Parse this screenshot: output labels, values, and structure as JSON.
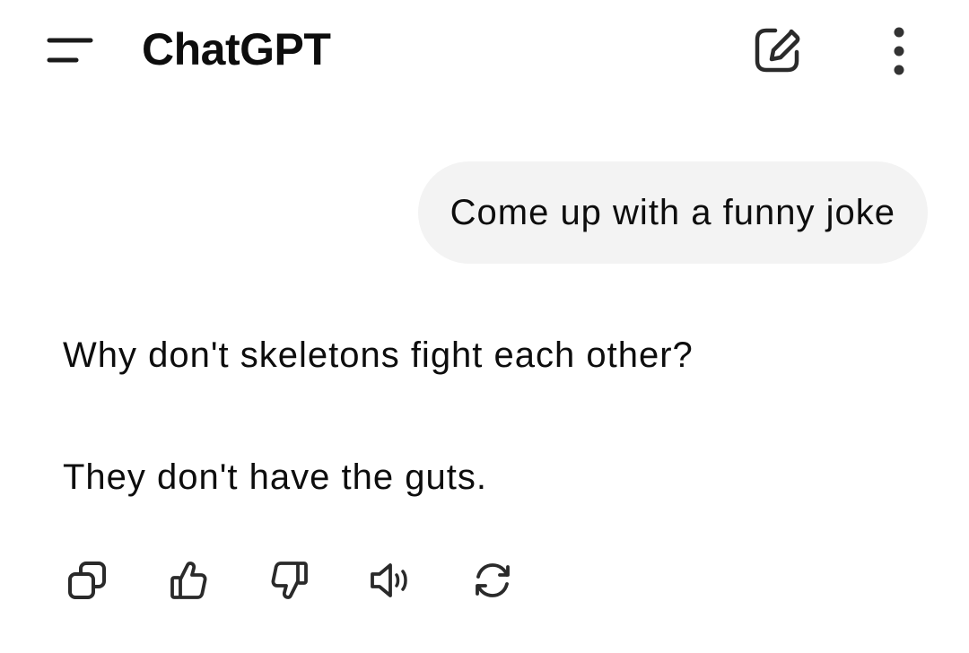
{
  "header": {
    "title": "ChatGPT",
    "menu_icon": "menu-icon",
    "new_chat_icon": "new-chat-icon",
    "more_icon": "more-vertical-icon"
  },
  "conversation": {
    "user_message": "Come up with a funny joke",
    "assistant_lines": [
      "Why don't skeletons fight each other?",
      "They don't have the guts."
    ]
  },
  "message_actions": [
    {
      "icon": "copy-icon"
    },
    {
      "icon": "thumbs-up-icon"
    },
    {
      "icon": "thumbs-down-icon"
    },
    {
      "icon": "read-aloud-icon"
    },
    {
      "icon": "regenerate-icon"
    }
  ],
  "colors": {
    "text": "#0d0d0d",
    "icon": "#2a2a2a",
    "user_bubble_bg": "#f3f3f3",
    "background": "#ffffff"
  }
}
